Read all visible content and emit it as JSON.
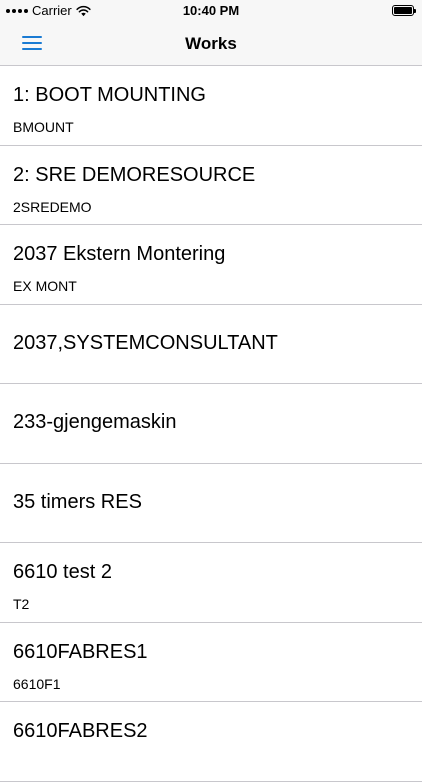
{
  "status_bar": {
    "carrier": "Carrier",
    "time": "10:40 PM"
  },
  "nav": {
    "title": "Works"
  },
  "works": [
    {
      "title": "1: BOOT MOUNTING",
      "subtitle": "BMOUNT"
    },
    {
      "title": "2: SRE DEMORESOURCE",
      "subtitle": "2SREDEMO"
    },
    {
      "title": "2037 Ekstern Montering",
      "subtitle": "EX MONT"
    },
    {
      "title": "2037,SYSTEMCONSULTANT",
      "subtitle": ""
    },
    {
      "title": "233-gjengemaskin",
      "subtitle": ""
    },
    {
      "title": "35 timers RES",
      "subtitle": ""
    },
    {
      "title": "6610 test 2",
      "subtitle": "T2"
    },
    {
      "title": "6610FABRES1",
      "subtitle": "6610F1"
    },
    {
      "title": "6610FABRES2",
      "subtitle": ""
    }
  ],
  "colors": {
    "accent": "#1a7bd3",
    "separator": "#c8c7cc",
    "bar_background": "#f7f7f7"
  }
}
